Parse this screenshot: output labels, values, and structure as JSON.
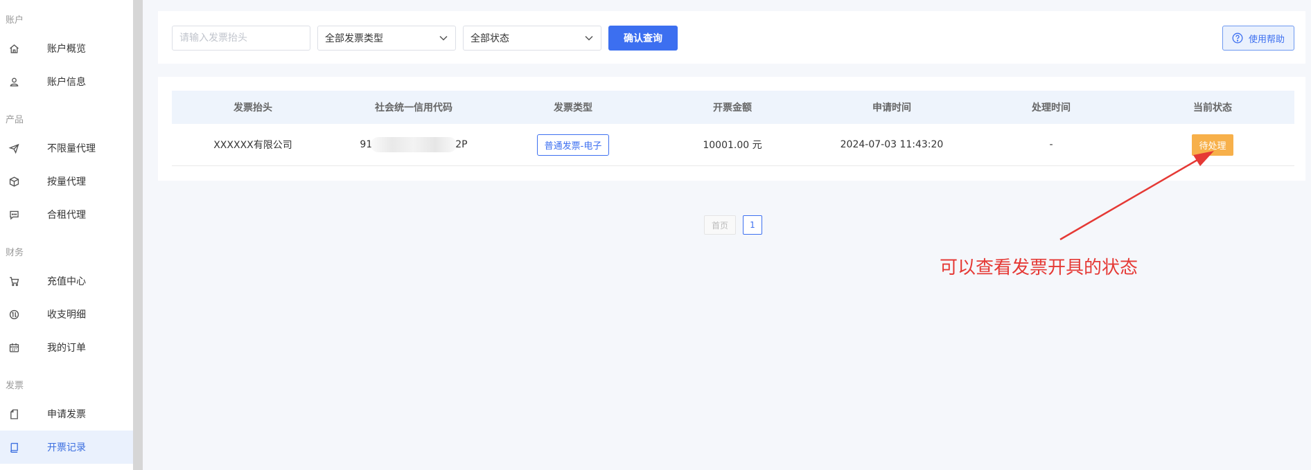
{
  "sidebar": {
    "groups": [
      {
        "label": "账户",
        "items": [
          {
            "label": "账户概览",
            "icon": "home-icon"
          },
          {
            "label": "账户信息",
            "icon": "user-icon"
          }
        ]
      },
      {
        "label": "产品",
        "items": [
          {
            "label": "不限量代理",
            "icon": "send-icon"
          },
          {
            "label": "按量代理",
            "icon": "cube-icon"
          },
          {
            "label": "合租代理",
            "icon": "chat-icon"
          }
        ]
      },
      {
        "label": "财务",
        "items": [
          {
            "label": "充值中心",
            "icon": "cart-icon"
          },
          {
            "label": "收支明细",
            "icon": "exchange-icon"
          },
          {
            "label": "我的订单",
            "icon": "calendar-icon"
          }
        ]
      },
      {
        "label": "发票",
        "items": [
          {
            "label": "申请发票",
            "icon": "file-icon"
          },
          {
            "label": "开票记录",
            "icon": "book-icon",
            "active": true
          }
        ]
      }
    ],
    "active_color": "#3c6fe0"
  },
  "filters": {
    "search_placeholder": "请输入发票抬头",
    "type_select": "全部发票类型",
    "status_select": "全部状态",
    "confirm_label": "确认查询",
    "help_label": "使用帮助"
  },
  "table": {
    "headers": [
      "发票抬头",
      "社会统一信用代码",
      "发票类型",
      "开票金额",
      "申请时间",
      "处理时间",
      "当前状态"
    ],
    "rows": [
      {
        "title": "XXXXXX有限公司",
        "code_prefix": "91",
        "code_suffix": "2P",
        "type": "普通发票-电子",
        "amount": "10001.00 元",
        "apply_time": "2024-07-03 11:43:20",
        "process_time": "-",
        "status": "待处理"
      }
    ]
  },
  "pagination": {
    "first_label": "首页",
    "current_page": "1"
  },
  "annotation": {
    "text": "可以查看发票开具的状态",
    "color": "#e53935"
  },
  "colors": {
    "primary": "#3c6ff0",
    "status_pending": "#f7b04a"
  }
}
